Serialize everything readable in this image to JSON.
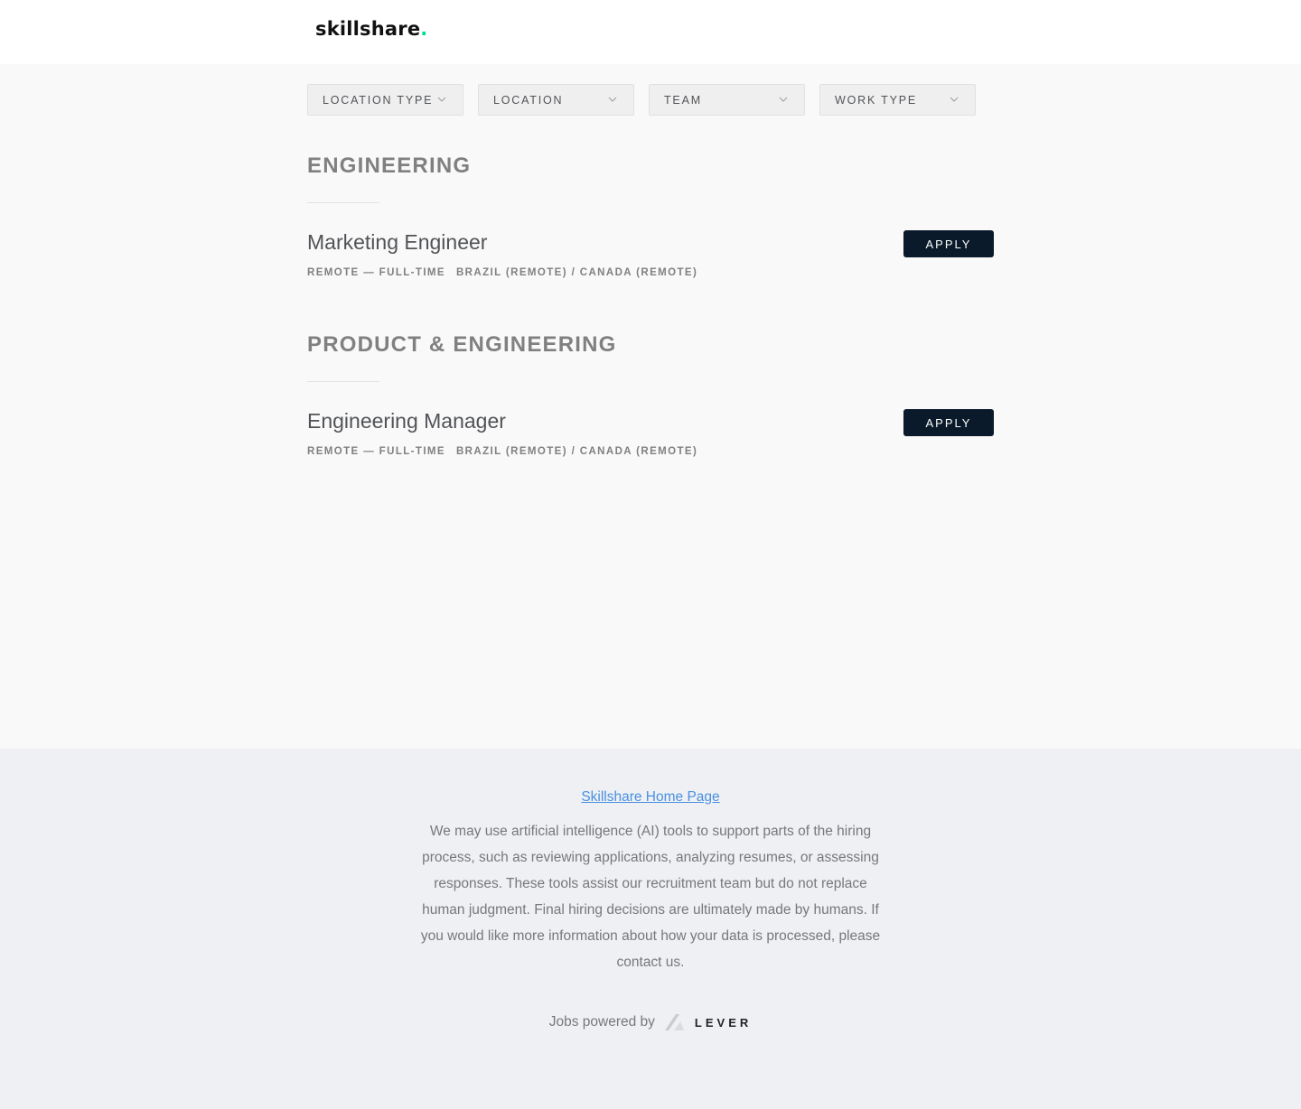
{
  "header": {
    "logo_text": "skillshare",
    "logo_dot": ".",
    "accent": "#00e08a"
  },
  "filters": [
    {
      "label": "LOCATION TYPE",
      "icon": "chevron-down-icon"
    },
    {
      "label": "LOCATION",
      "icon": "chevron-down-icon"
    },
    {
      "label": "TEAM",
      "icon": "chevron-down-icon"
    },
    {
      "label": "WORK TYPE",
      "icon": "chevron-down-icon"
    }
  ],
  "sections": [
    {
      "title": "ENGINEERING",
      "postings": [
        {
          "title": "Marketing Engineer",
          "commitment": "REMOTE — FULL-TIME",
          "location": "BRAZIL (REMOTE) / CANADA (REMOTE)",
          "apply_label": "APPLY"
        }
      ]
    },
    {
      "title": "PRODUCT & ENGINEERING",
      "postings": [
        {
          "title": "Engineering Manager",
          "commitment": "REMOTE — FULL-TIME",
          "location": "BRAZIL (REMOTE) / CANADA (REMOTE)",
          "apply_label": "APPLY"
        }
      ]
    }
  ],
  "footer": {
    "home_link": "Skillshare Home Page",
    "disclaimer": "We may use artificial intelligence (AI) tools to support parts of the hiring process, such as reviewing applications, analyzing resumes, or assessing responses. These tools assist our recruitment team but do not replace human judgment. Final hiring decisions are ultimately made by humans. If you would like more information about how your data is processed, please contact us.",
    "powered_by": "Jobs powered by",
    "lever_text": "LEVER",
    "link_color": "#4a90e2"
  },
  "colors": {
    "apply_button": "#0a1a2a",
    "page_background": "#f9f9f9",
    "footer_background": "#eef0f3"
  }
}
